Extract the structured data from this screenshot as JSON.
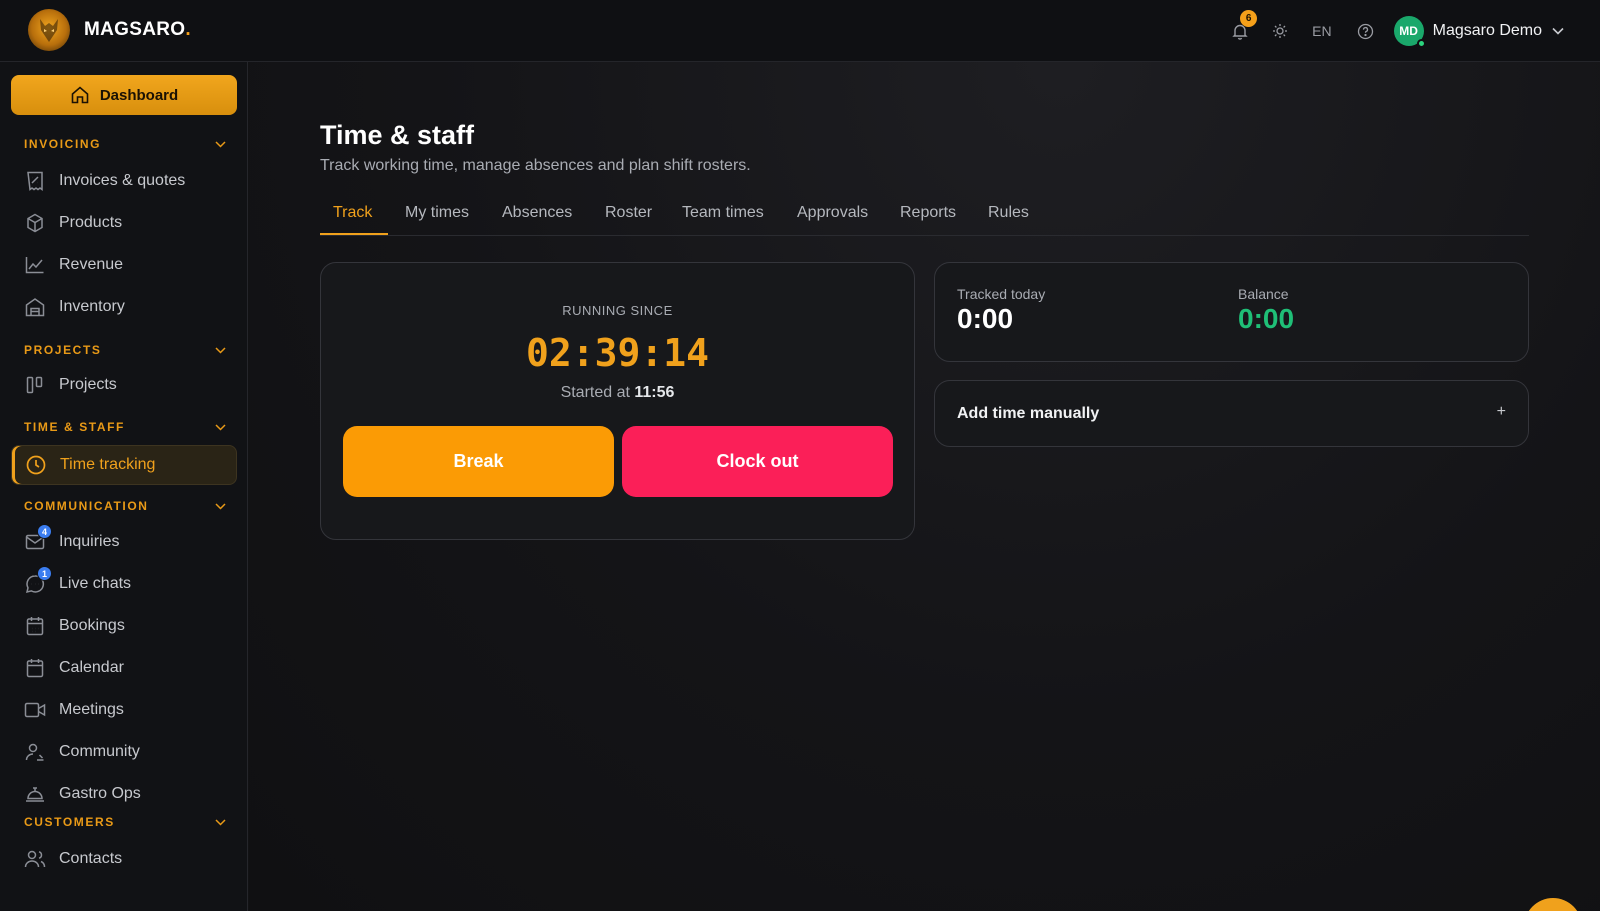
{
  "header": {
    "brand_name": "MAGSARO",
    "brand_dot": ".",
    "notifications_count": "6",
    "language": "EN",
    "user_initials": "MD",
    "user_name": "Magsaro Demo"
  },
  "sidebar": {
    "dashboard_label": "Dashboard",
    "sections": {
      "invoicing": "INVOICING",
      "projects": "PROJECTS",
      "time_staff": "TIME & STAFF",
      "communication": "COMMUNICATION",
      "customers": "CUSTOMERS"
    },
    "items": {
      "invoices": "Invoices & quotes",
      "products": "Products",
      "revenue": "Revenue",
      "inventory": "Inventory",
      "projects": "Projects",
      "time_tracking": "Time tracking",
      "inquiries": "Inquiries",
      "inquiries_badge": "4",
      "live_chats": "Live chats",
      "live_chats_badge": "1",
      "bookings": "Bookings",
      "calendar": "Calendar",
      "meetings": "Meetings",
      "community": "Community",
      "gastro_ops": "Gastro Ops",
      "contacts": "Contacts"
    }
  },
  "main": {
    "title": "Time & staff",
    "subtitle": "Track working time, manage absences and plan shift rosters.",
    "tabs": [
      "Track",
      "My times",
      "Absences",
      "Roster",
      "Team times",
      "Approvals",
      "Reports",
      "Rules"
    ],
    "active_tab": "Track",
    "timer": {
      "running_label": "RUNNING SINCE",
      "elapsed": "02:39:14",
      "started_prefix": "Started at",
      "started_time": "11:56",
      "break_label": "Break",
      "clock_out_label": "Clock out"
    },
    "stats": {
      "tracked_label": "Tracked today",
      "tracked_value": "0:00",
      "balance_label": "Balance",
      "balance_value": "0:00"
    },
    "add_time": {
      "label": "Add time manually",
      "plus": "+"
    }
  },
  "colors": {
    "accent": "#f0a11c",
    "break": "#fb9b05",
    "clock_out": "#fb1f58",
    "balance": "#1fbf77",
    "badge_blue": "#3b7df0"
  }
}
